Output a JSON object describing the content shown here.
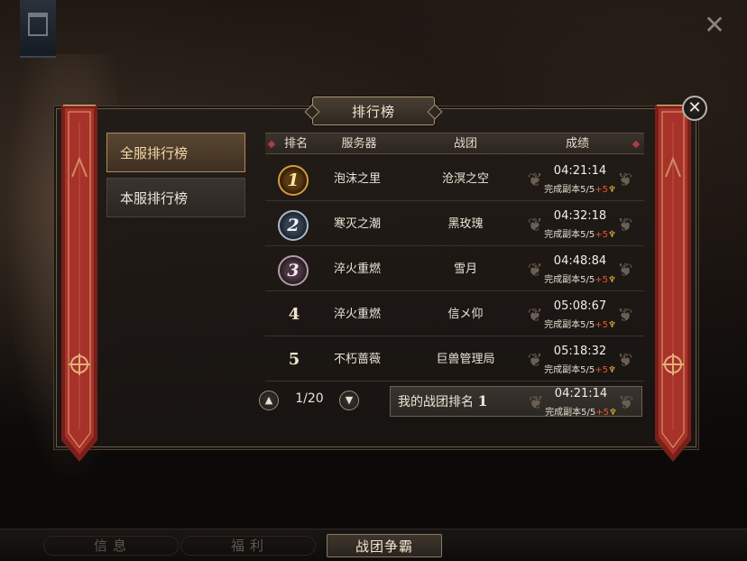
{
  "panel": {
    "title": "排行榜"
  },
  "tabs": [
    {
      "label": "全服排行榜",
      "active": true
    },
    {
      "label": "本服排行榜",
      "active": false
    }
  ],
  "table": {
    "headers": [
      "排名",
      "服务器",
      "战团",
      "成绩"
    ],
    "rows": [
      {
        "rank": "1",
        "medal": "gold",
        "server": "泡沫之里",
        "team": "沧溟之空",
        "time": "04:21:14",
        "detail": "完成副本5/5",
        "bonus": "+5"
      },
      {
        "rank": "2",
        "medal": "silver",
        "server": "寒灭之潮",
        "team": "黑玫瑰",
        "time": "04:32:18",
        "detail": "完成副本5/5",
        "bonus": "+5"
      },
      {
        "rank": "3",
        "medal": "bronze",
        "server": "淬火重燃",
        "team": "雪月",
        "time": "04:48:84",
        "detail": "完成副本5/5",
        "bonus": "+5"
      },
      {
        "rank": "4",
        "medal": "",
        "server": "淬火重燃",
        "team": "信メ仰",
        "time": "05:08:67",
        "detail": "完成副本5/5",
        "bonus": "+5"
      },
      {
        "rank": "5",
        "medal": "",
        "server": "不朽蔷薇",
        "team": "巨兽管理局",
        "time": "05:18:32",
        "detail": "完成副本5/5",
        "bonus": "+5"
      }
    ]
  },
  "pager": {
    "text": "1/20"
  },
  "my_rank": {
    "label": "我的战团排名",
    "rank": "1",
    "time": "04:21:14",
    "detail": "完成副本5/5",
    "bonus": "+5"
  },
  "bottom_nav": [
    {
      "label": "信息",
      "active": false
    },
    {
      "label": "福利",
      "active": false
    },
    {
      "label": "战团争霸",
      "active": true
    }
  ],
  "colors": {
    "accent": "#b08a5c",
    "banner": "#a8322a",
    "bonus": "#e05a3a",
    "trophy": "#f0b43a"
  }
}
